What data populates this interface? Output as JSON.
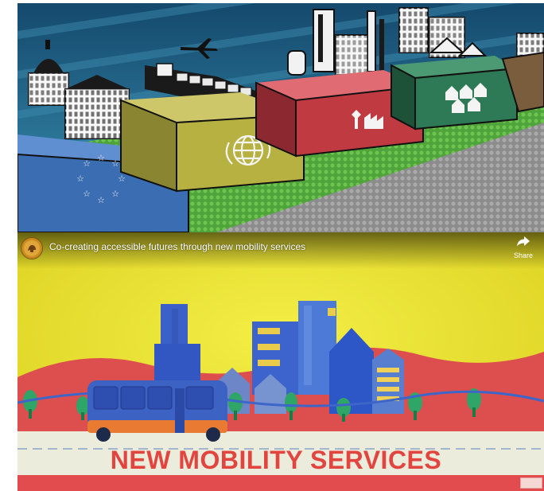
{
  "video": {
    "title": "Co-creating accessible futures through new mobility services",
    "share_label": "Share",
    "headline": "NEW MOBILITY SERVICES"
  },
  "icons": {
    "channel": "channel-logo-icon",
    "share": "share-arrow-icon",
    "eu": "eu-stars-icon",
    "globe": "globe-arrows-icon",
    "factory": "factory-wheat-icon",
    "houses": "houses-icon"
  },
  "colors": {
    "top_sky": "#1e5c82",
    "block_blue": "#3a6db2",
    "block_yellow": "#b7b141",
    "block_red": "#c03a42",
    "block_green": "#2f7a56",
    "grass": "#52a83a",
    "bottom_bg": "#e6e02b",
    "hills": "#dd4e4f",
    "bus": "#3c62c4",
    "headline": "#e2453f"
  }
}
